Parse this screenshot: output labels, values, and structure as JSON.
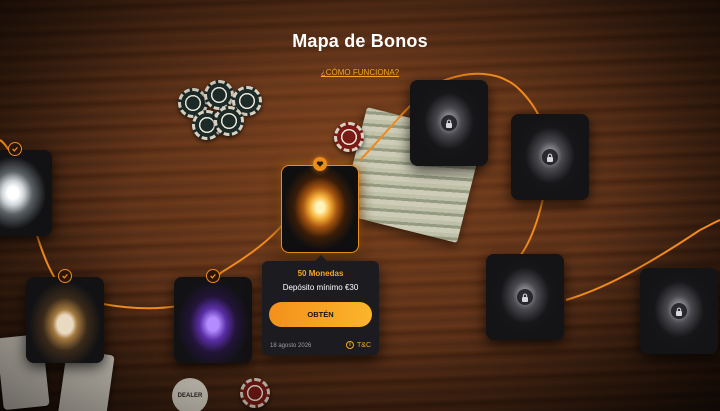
{
  "page": {
    "title": "Mapa de Bonos",
    "how_it_works_link": "¿CÓMO FUNCIONA?"
  },
  "nodes": [
    {
      "id": "diamond",
      "state": "completed",
      "icon": "diamond-icon"
    },
    {
      "id": "pearl-shell",
      "state": "completed",
      "icon": "pearl-shell-icon"
    },
    {
      "id": "amethyst",
      "state": "completed",
      "icon": "amethyst-icon"
    },
    {
      "id": "gold-gem",
      "state": "active",
      "icon": "gold-gem-icon"
    },
    {
      "id": "locked-1",
      "state": "locked",
      "icon": "lock-icon"
    },
    {
      "id": "locked-2",
      "state": "locked",
      "icon": "lock-icon"
    },
    {
      "id": "locked-3",
      "state": "locked",
      "icon": "lock-icon"
    },
    {
      "id": "locked-4",
      "state": "locked",
      "icon": "lock-icon"
    }
  ],
  "popup": {
    "reward": "50 Monedas",
    "requirement": "Depósito mínimo €30",
    "button_label": "OBTÉN",
    "date": "18 agosto 2026",
    "terms_label": "T&C",
    "info_glyph": "i"
  },
  "decor": {
    "dealer_button": "DEALER"
  },
  "colors": {
    "accent": "#f08a1c",
    "accent_text": "#f5a623",
    "card_bg": "#1c1c20",
    "node_bg": "#121214"
  }
}
